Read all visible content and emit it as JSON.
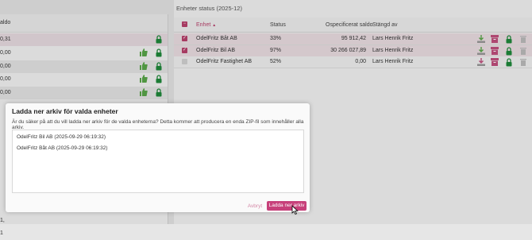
{
  "left_panel": {
    "column_label": "aldo",
    "rows": [
      "0,31",
      "0,00",
      "0,00",
      "0,00",
      "0,00"
    ],
    "bottom_values": [
      "0",
      "0",
      "0",
      "0",
      "0",
      "1,",
      "1"
    ]
  },
  "right_panel": {
    "title": "Enheter status (2025-12)",
    "headers": {
      "entity": "Enhet",
      "sort_indicator": "▲",
      "status": "Status",
      "unspecified_balance": "Ospecificerat saldo",
      "closed_by": "Stängd av"
    },
    "rows": [
      {
        "entity": "OdelFritz Båt AB",
        "status": "33%",
        "balance": "95 912,42",
        "closed_by": "Lars Henrik Fritz",
        "checked": true
      },
      {
        "entity": "OdelFritz Bil AB",
        "status": "97%",
        "balance": "30 266 027,89",
        "closed_by": "Lars Henrik Fritz",
        "checked": true
      },
      {
        "entity": "OdelFritz Fastighet AB",
        "status": "52%",
        "balance": "0,00",
        "closed_by": "Lars Henrik Fritz",
        "checked": false
      }
    ]
  },
  "dialog": {
    "title": "Ladda ner arkiv för valda enheter",
    "message": "Är du säker på att du vill ladda ner arkiv för de valda enheterna? Detta kommer att producera en enda ZIP-fil som innehåller alla arkiv.",
    "items": [
      "OdelFritz Bil AB (2025-09-29 06:19:32)",
      "OdelFritz Båt AB (2025-09-29 06:19:32)"
    ],
    "cancel_label": "Avbryt",
    "confirm_label": "Ladda ner arkiv"
  },
  "colors": {
    "accent": "#c7407a",
    "thumb_green": "#5aa84a",
    "lock_green": "#1f8a3a",
    "archive_pink": "#c2507e",
    "download_gray": "#9a9a9a"
  },
  "icons": [
    "thumbs-up-icon",
    "lock-icon",
    "download-icon",
    "archive-box-icon",
    "trash-icon",
    "checkbox-icon",
    "cursor-icon"
  ]
}
